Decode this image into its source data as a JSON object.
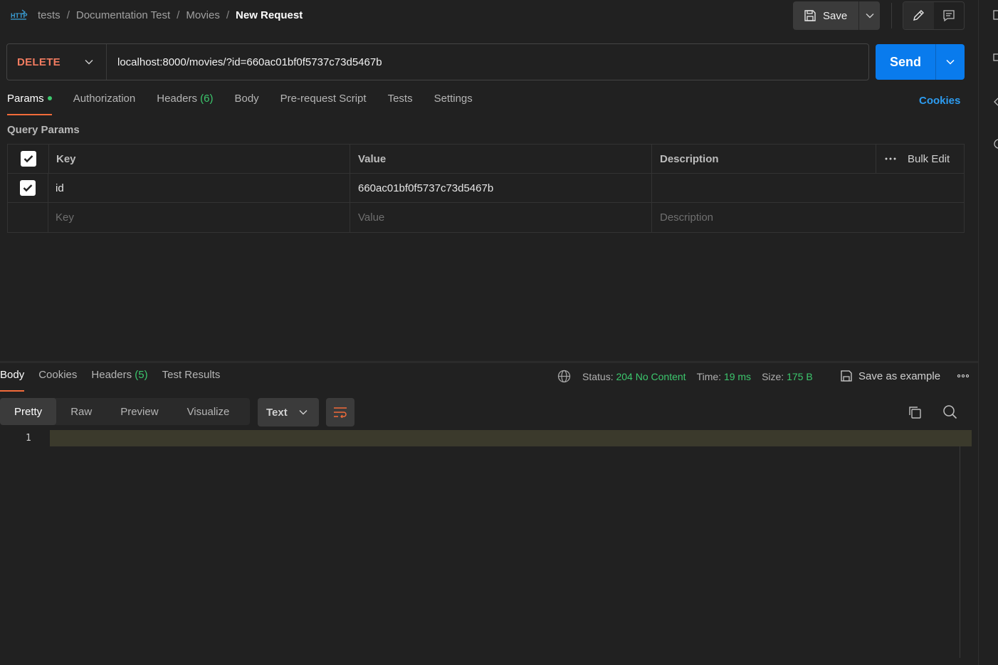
{
  "breadcrumb": {
    "icon": "http-icon",
    "items": [
      "tests",
      "Documentation Test",
      "Movies"
    ],
    "current": "New Request",
    "separator": "/"
  },
  "toolbar": {
    "save_label": "Save"
  },
  "request": {
    "method": "DELETE",
    "url": "localhost:8000/movies/?id=660ac01bf0f5737c73d5467b",
    "send_label": "Send"
  },
  "request_tabs": {
    "params": "Params",
    "authorization": "Authorization",
    "headers": "Headers",
    "headers_count": "(6)",
    "body": "Body",
    "prerequest": "Pre-request Script",
    "tests": "Tests",
    "settings": "Settings",
    "cookies": "Cookies"
  },
  "query_params": {
    "title": "Query Params",
    "columns": {
      "key": "Key",
      "value": "Value",
      "description": "Description",
      "bulk_edit": "Bulk Edit"
    },
    "rows": [
      {
        "checked": true,
        "key": "id",
        "value": "660ac01bf0f5737c73d5467b",
        "description": ""
      }
    ],
    "placeholders": {
      "key": "Key",
      "value": "Value",
      "description": "Description"
    }
  },
  "response_tabs": {
    "body": "Body",
    "cookies": "Cookies",
    "headers": "Headers",
    "headers_count": "(5)",
    "test_results": "Test Results"
  },
  "response_status": {
    "status_label": "Status:",
    "status_value": "204 No Content",
    "time_label": "Time:",
    "time_value": "19 ms",
    "size_label": "Size:",
    "size_value": "175 B",
    "save_example": "Save as example"
  },
  "view_tabs": [
    "Pretty",
    "Raw",
    "Preview",
    "Visualize"
  ],
  "format": "Text",
  "editor": {
    "line_numbers": [
      "1"
    ]
  },
  "colors": {
    "accent_orange": "#f26b3a",
    "method_delete": "#f27c60",
    "send_blue": "#097bed",
    "success_green": "#3cc76d",
    "link_blue": "#2d9cf0"
  }
}
